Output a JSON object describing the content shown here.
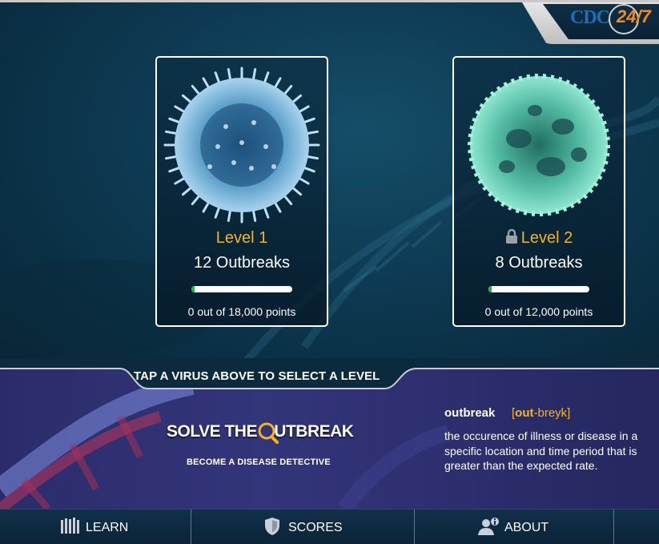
{
  "brand": {
    "logo_text": "CDC",
    "logo_accent": "24/7",
    "accent_color": "#f28c1b",
    "logo_color": "#1f6fb8"
  },
  "levels": [
    {
      "title": "Level 1",
      "outbreaks": "12 Outbreaks",
      "points": "0 out of 18,000 points",
      "locked": false,
      "progress": 0.03,
      "icon": "blue-virus-icon"
    },
    {
      "title": "Level 2",
      "outbreaks": "8 Outbreaks",
      "points": "0 out of 12,000 points",
      "locked": true,
      "progress": 0.03,
      "icon": "green-virus-icon"
    }
  ],
  "instruction": "TAP A VIRUS ABOVE TO SELECT A LEVEL",
  "promo": {
    "title_left": "SOLVE THE ",
    "title_right": "UTBREAK",
    "tagline": "BECOME A DISEASE DETECTIVE"
  },
  "glossary": {
    "term": "outbreak",
    "pron_open": "[",
    "pron_bold": "out",
    "pron_rest": "-breyk]",
    "definition_lines": [
      "the occurence of illness or disease in a",
      "specific location and time period that is",
      "greater than the expected rate."
    ]
  },
  "nav": [
    {
      "label": "LEARN",
      "icon": "library-books-icon"
    },
    {
      "label": "SCORES",
      "icon": "shield-icon"
    },
    {
      "label": "ABOUT",
      "icon": "user-info-icon"
    }
  ],
  "colors": {
    "level_title": "#f2b51b",
    "progress": "#1db83a"
  }
}
